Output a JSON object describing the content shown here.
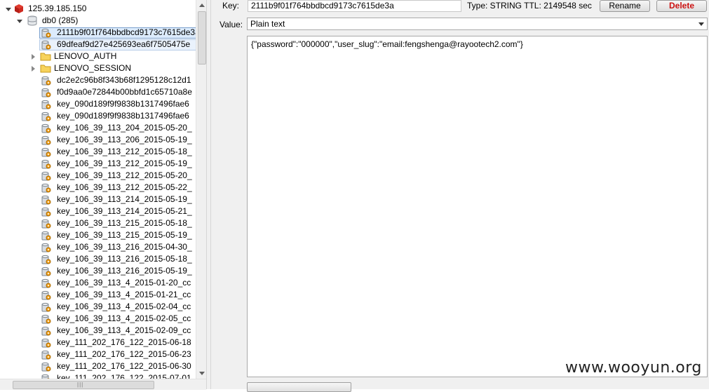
{
  "tree": {
    "server": "125.39.185.150",
    "db": "db0 (285)",
    "keys": [
      "2111b9f01f764bbdbcd9173c7615de3a",
      "69dfeaf9d27e425693ea6f7505475e",
      "LENOVO_AUTH",
      "LENOVO_SESSION",
      "dc2e2c96b8f343b68f1295128c12d1",
      "f0d9aa0e72844b00bbfd1c65710a8e",
      "key_090d189f9f9838b1317496fae6",
      "key_090d189f9f9838b1317496fae6",
      "key_106_39_113_204_2015-05-20_",
      "key_106_39_113_206_2015-05-19_",
      "key_106_39_113_212_2015-05-18_",
      "key_106_39_113_212_2015-05-19_",
      "key_106_39_113_212_2015-05-20_",
      "key_106_39_113_212_2015-05-22_",
      "key_106_39_113_214_2015-05-19_",
      "key_106_39_113_214_2015-05-21_",
      "key_106_39_113_215_2015-05-18_",
      "key_106_39_113_215_2015-05-19_",
      "key_106_39_113_216_2015-04-30_",
      "key_106_39_113_216_2015-05-18_",
      "key_106_39_113_216_2015-05-19_",
      "key_106_39_113_4_2015-01-20_cc",
      "key_106_39_113_4_2015-01-21_cc",
      "key_106_39_113_4_2015-02-04_cc",
      "key_106_39_113_4_2015-02-05_cc",
      "key_106_39_113_4_2015-02-09_cc",
      "key_111_202_176_122_2015-06-18",
      "key_111_202_176_122_2015-06-23",
      "key_111_202_176_122_2015-06-30",
      "key_111_202_176_122_2015-07-01"
    ]
  },
  "detail": {
    "key_label": "Key:",
    "key_value": "2111b9f01f764bbdbcd9173c7615de3a",
    "type_ttl": "Type: STRING  TTL: 2149548 sec",
    "rename_label": "Rename",
    "delete_label": "Delete",
    "value_label": "Value:",
    "format_selected": "Plain text",
    "value_text": "{\"password\":\"000000\",\"user_slug\":\"email:fengshenga@rayootech2.com\"}"
  },
  "watermark": "www.wooyun.org"
}
